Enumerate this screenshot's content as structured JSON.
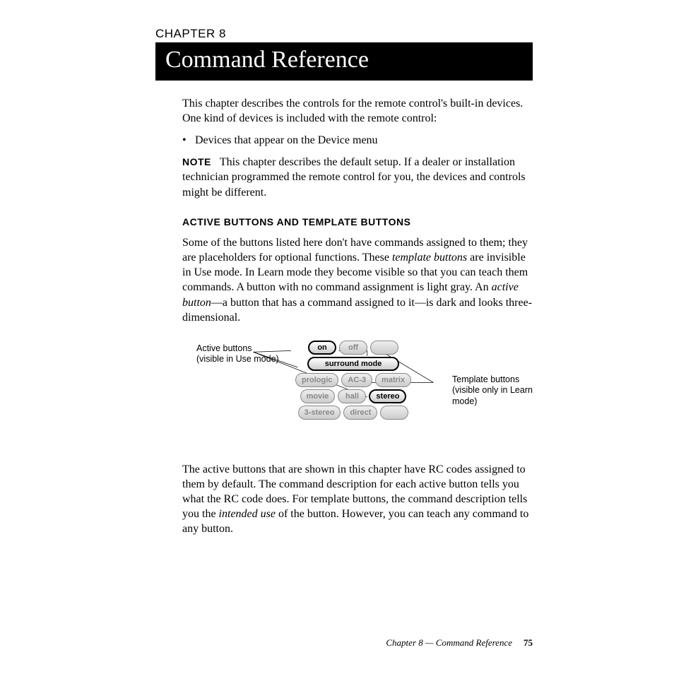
{
  "chapter_label": "CHAPTER 8",
  "title": "Command Reference",
  "intro_p1": "This chapter describes the controls for the remote control's built-in devices. One kind of devices is included with the remote control:",
  "bullet_1": "Devices that appear on the Device menu",
  "note_label": "NOTE",
  "note_text": "This chapter describes the default setup. If a dealer or installation technician programmed the remote control for you, the devices and controls might be different.",
  "subhead": "ACTIVE BUTTONS AND TEMPLATE BUTTONS",
  "para2_a": "Some of the buttons listed here don't have commands assigned to them; they are placeholders for optional functions. These ",
  "para2_em1": "template buttons",
  "para2_b": " are invisible in Use mode. In Learn mode they become visible so that you can teach them commands. A button with no command assignment is light gray. An ",
  "para2_em2": "active button",
  "para2_c": "—a button that has a command assigned to it—is dark and looks three-dimensional.",
  "diagram": {
    "left_callout_line1": "Active buttons",
    "left_callout_line2": "(visible in Use mode)",
    "right_callout_line1": "Template buttons",
    "right_callout_line2": "(visible only in Learn mode)",
    "rows": [
      [
        {
          "label": "on",
          "active": true
        },
        {
          "label": "off",
          "active": false
        },
        {
          "label": "",
          "active": false,
          "blank": true
        }
      ],
      [
        {
          "label": "surround mode",
          "active": true,
          "wide": true
        }
      ],
      [
        {
          "label": "prologic",
          "active": false
        },
        {
          "label": "AC-3",
          "active": false
        },
        {
          "label": "matrix",
          "active": false
        }
      ],
      [
        {
          "label": "movie",
          "active": false
        },
        {
          "label": "hall",
          "active": false
        },
        {
          "label": "stereo",
          "active": true
        }
      ],
      [
        {
          "label": "3-stereo",
          "active": false
        },
        {
          "label": "direct",
          "active": false
        },
        {
          "label": "",
          "active": false,
          "blank": true
        }
      ]
    ]
  },
  "para3_a": "The active buttons that are shown in this chapter have RC codes assigned to them by default. The command description for each active button tells you what the RC code does. For template buttons, the command description tells you the ",
  "para3_em": "intended use",
  "para3_b": " of the button. However, you can teach any command to any button.",
  "footer_text": "Chapter 8 — Command Reference",
  "page_number": "75"
}
